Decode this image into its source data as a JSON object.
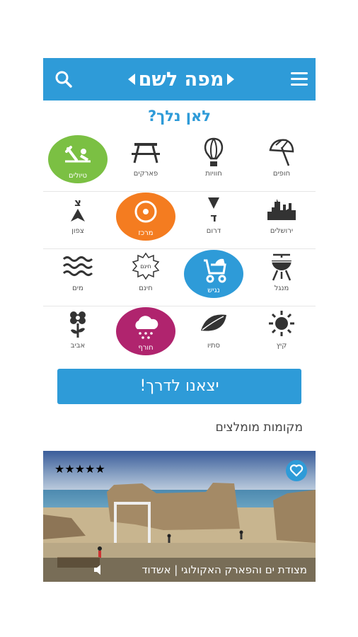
{
  "app": {
    "logo_text": "מפה לשם"
  },
  "header": {
    "menu_icon": "hamburger-icon",
    "search_icon": "search-icon"
  },
  "main": {
    "title": "לאן נלך?"
  },
  "categories": [
    {
      "label": "חופים",
      "icon": "beach-umbrella-icon"
    },
    {
      "label": "חוויות",
      "icon": "hot-air-balloon-icon"
    },
    {
      "label": "פארקים",
      "icon": "picnic-table-icon"
    },
    {
      "label": "טיולים",
      "icon": "hiking-icon",
      "active": true,
      "color": "#7bc043"
    },
    {
      "label": "ירושלים",
      "icon": "jerusalem-skyline-icon"
    },
    {
      "label": "דרום",
      "icon": "south-arrow-icon"
    },
    {
      "label": "מרכז",
      "icon": "center-target-icon",
      "active": true,
      "color": "#f47c20"
    },
    {
      "label": "צפון",
      "icon": "north-arrow-icon"
    },
    {
      "label": "מנגל",
      "icon": "bbq-grill-icon"
    },
    {
      "label": "נגיש",
      "icon": "stroller-icon",
      "active": true,
      "color": "#2e9bd8"
    },
    {
      "label": "חינם",
      "icon": "free-badge-icon"
    },
    {
      "label": "מים",
      "icon": "water-waves-icon"
    },
    {
      "label": "קיץ",
      "icon": "sun-icon"
    },
    {
      "label": "סתיו",
      "icon": "leaf-icon"
    },
    {
      "label": "חורף",
      "icon": "rain-cloud-icon",
      "active": true,
      "color": "#b0246e"
    },
    {
      "label": "אביב",
      "icon": "flower-icon"
    }
  ],
  "cta": {
    "label": "יצאנו לדרך!"
  },
  "recommended": {
    "title": "מקומות מומלצים",
    "card": {
      "caption": "מצודת ים והפארק האקולוגי | אשדוד",
      "rating": 5,
      "stars": "★★★★★",
      "fav_icon": "heart-icon",
      "sound_icon": "speaker-icon"
    }
  },
  "colors": {
    "brand": "#2e9bd8",
    "green": "#7bc043",
    "orange": "#f47c20",
    "magenta": "#b0246e"
  }
}
